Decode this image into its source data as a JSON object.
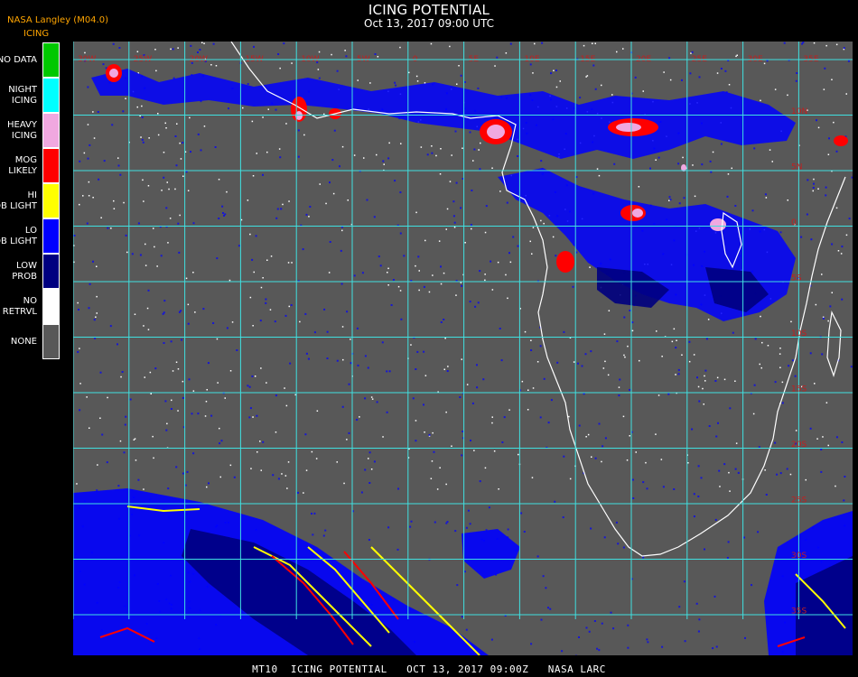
{
  "header": {
    "title": "ICING POTENTIAL",
    "subtitle": "Oct 13, 2017 09:00 UTC",
    "source": "NASA Langley (M04.0)",
    "legend_title": "ICING"
  },
  "legend": [
    {
      "label": "NO DATA",
      "color": "#00c800"
    },
    {
      "label": "NIGHT ICING",
      "color": "#00ffff"
    },
    {
      "label": "HEAVY ICING",
      "color": "#f0a8e0"
    },
    {
      "label": "MOG LIKELY",
      "color": "#ff0000"
    },
    {
      "label": "HI PROB LIGHT",
      "color": "#ffff00"
    },
    {
      "label": "LO PROB LIGHT",
      "color": "#0000ff"
    },
    {
      "label": "LOW PROB",
      "color": "#000080"
    },
    {
      "label": "NO RETRVL",
      "color": "#ffffff"
    },
    {
      "label": "NONE",
      "color": "#585858"
    }
  ],
  "map": {
    "background_color": "#585858",
    "grid_color": "#40e0e0",
    "coast_color": "#ffffff",
    "label_color": "#c02020",
    "lon_labels": [
      "30W",
      "25W",
      "20W",
      "15W",
      "10W",
      "5W",
      "0",
      "5E",
      "10E",
      "15E",
      "20E",
      "25E",
      "30E",
      "35E"
    ],
    "lat_labels": [
      "10N",
      "5N",
      "0",
      "5S",
      "10S",
      "15S",
      "20S",
      "25S",
      "30S",
      "35S",
      "40S",
      "45S"
    ]
  },
  "footer": {
    "text": "MT10  ICING POTENTIAL   OCT 13, 2017 09:00Z   NASA LARC"
  }
}
